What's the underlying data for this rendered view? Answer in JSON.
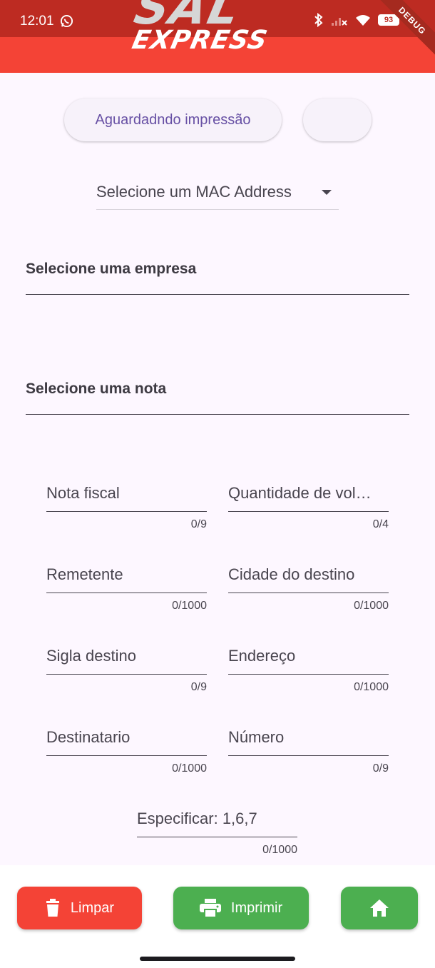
{
  "status_bar": {
    "time": "12:01",
    "battery": "93"
  },
  "app_bar": {
    "logo_top": "SAL",
    "logo_bottom": "EXPRESS",
    "debug_banner": "DEBUG",
    "background_color": "#f44336"
  },
  "printer": {
    "status_label": "Aguardadndo impressão"
  },
  "mac_dropdown": {
    "placeholder": "Selecione um MAC Address"
  },
  "company_select": {
    "label": "Selecione uma empresa"
  },
  "note_select": {
    "label": "Selecione uma nota"
  },
  "fields": [
    {
      "label": "Nota fiscal",
      "counter": "0/9"
    },
    {
      "label": "Quantidade de vol…",
      "counter": "0/4"
    },
    {
      "label": "Remetente",
      "counter": "0/1000"
    },
    {
      "label": "Cidade do destino",
      "counter": "0/1000"
    },
    {
      "label": "Sigla destino",
      "counter": "0/9"
    },
    {
      "label": "Endereço",
      "counter": "0/1000"
    },
    {
      "label": "Destinatario",
      "counter": "0/1000"
    },
    {
      "label": "Número",
      "counter": "0/9"
    },
    {
      "label": "Especificar: 1,6,7",
      "counter": "0/1000"
    }
  ],
  "actions": {
    "clear_label": "Limpar",
    "print_label": "Imprimir",
    "clear_color": "#f44336",
    "print_color": "#4caf50",
    "home_color": "#4caf50"
  }
}
